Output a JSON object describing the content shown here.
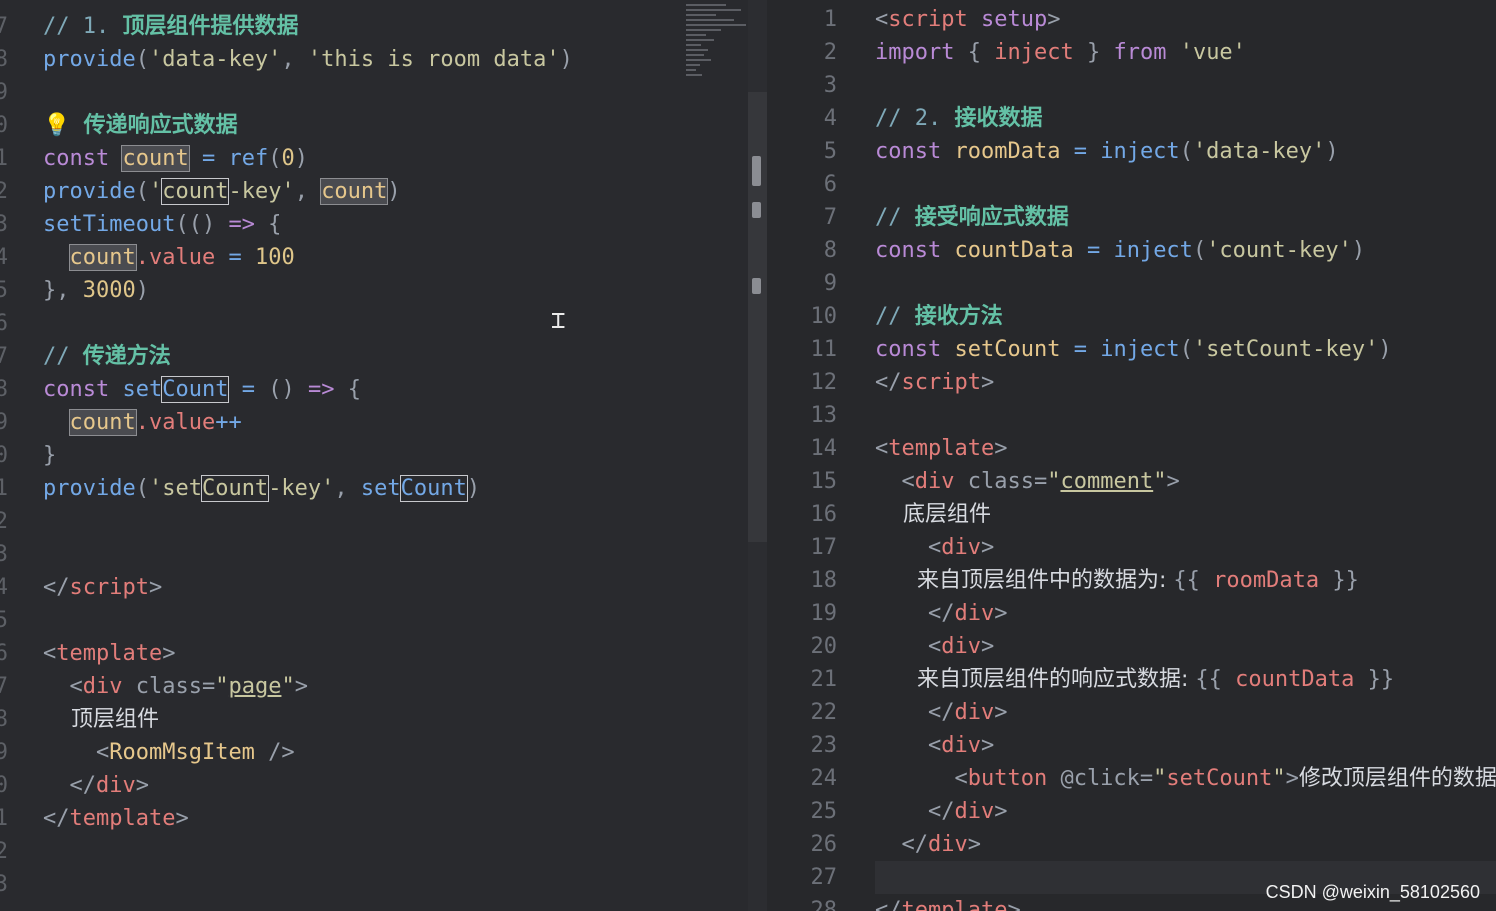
{
  "left": {
    "lines": [
      {
        "no": "7",
        "parts": [
          {
            "c": "cm",
            "t": "// 1. "
          },
          {
            "c": "cmb",
            "t": "顶层组件提供数据"
          }
        ]
      },
      {
        "no": "8",
        "parts": [
          {
            "c": "fn",
            "t": "provide"
          },
          {
            "c": "pr",
            "t": "("
          },
          {
            "c": "str",
            "t": "'data-key'"
          },
          {
            "c": "pr",
            "t": ", "
          },
          {
            "c": "str",
            "t": "'this is room data'"
          },
          {
            "c": "pr",
            "t": ")"
          }
        ]
      },
      {
        "no": "9",
        "parts": []
      },
      {
        "no": "0",
        "parts": [
          {
            "c": "num",
            "t": "💡 "
          },
          {
            "c": "cmb",
            "t": "传递响应式数据"
          }
        ]
      },
      {
        "no": "1",
        "parts": [
          {
            "c": "kw",
            "t": "const "
          },
          {
            "c": "var hl",
            "t": "count"
          },
          {
            "c": "op",
            "t": " = "
          },
          {
            "c": "fn",
            "t": "ref"
          },
          {
            "c": "pr",
            "t": "("
          },
          {
            "c": "num",
            "t": "0"
          },
          {
            "c": "pr",
            "t": ")"
          }
        ]
      },
      {
        "no": "2",
        "parts": [
          {
            "c": "fn",
            "t": "provide"
          },
          {
            "c": "pr",
            "t": "("
          },
          {
            "c": "str",
            "t": "'"
          },
          {
            "c": "str box",
            "t": "count"
          },
          {
            "c": "str",
            "t": "-key'"
          },
          {
            "c": "pr",
            "t": ", "
          },
          {
            "c": "var hl",
            "t": "count"
          },
          {
            "c": "pr",
            "t": ")"
          }
        ]
      },
      {
        "no": "3",
        "parts": [
          {
            "c": "fn",
            "t": "setTimeout"
          },
          {
            "c": "pr",
            "t": "(() "
          },
          {
            "c": "kw",
            "t": "=>"
          },
          {
            "c": "pr",
            "t": " {"
          }
        ]
      },
      {
        "no": "4",
        "parts": [
          {
            "c": "pr",
            "t": "  "
          },
          {
            "c": "var hl",
            "t": "count"
          },
          {
            "c": "tag",
            "t": ".value"
          },
          {
            "c": "op",
            "t": " = "
          },
          {
            "c": "num",
            "t": "100"
          }
        ]
      },
      {
        "no": "5",
        "parts": [
          {
            "c": "pr",
            "t": "}, "
          },
          {
            "c": "num",
            "t": "3000"
          },
          {
            "c": "pr",
            "t": ")"
          }
        ]
      },
      {
        "no": "6",
        "parts": []
      },
      {
        "no": "7",
        "parts": [
          {
            "c": "cm",
            "t": "// "
          },
          {
            "c": "cmb",
            "t": "传递方法"
          }
        ]
      },
      {
        "no": "8",
        "parts": [
          {
            "c": "kw",
            "t": "const "
          },
          {
            "c": "fn",
            "t": "set"
          },
          {
            "c": "fn box",
            "t": "Count"
          },
          {
            "c": "op",
            "t": " = "
          },
          {
            "c": "pr",
            "t": "() "
          },
          {
            "c": "kw",
            "t": "=>"
          },
          {
            "c": "pr",
            "t": " {"
          }
        ]
      },
      {
        "no": "9",
        "parts": [
          {
            "c": "pr",
            "t": "  "
          },
          {
            "c": "var hl",
            "t": "count"
          },
          {
            "c": "tag",
            "t": ".value"
          },
          {
            "c": "op",
            "t": "++"
          }
        ]
      },
      {
        "no": "0",
        "parts": [
          {
            "c": "pr",
            "t": "}"
          }
        ]
      },
      {
        "no": "1",
        "parts": [
          {
            "c": "fn",
            "t": "provide"
          },
          {
            "c": "pr",
            "t": "("
          },
          {
            "c": "str",
            "t": "'set"
          },
          {
            "c": "str box",
            "t": "Count"
          },
          {
            "c": "str",
            "t": "-key'"
          },
          {
            "c": "pr",
            "t": ", "
          },
          {
            "c": "fn",
            "t": "set"
          },
          {
            "c": "fn box",
            "t": "Count"
          },
          {
            "c": "pr",
            "t": ")"
          }
        ]
      },
      {
        "no": "2",
        "parts": []
      },
      {
        "no": "3",
        "parts": []
      },
      {
        "no": "4",
        "parts": [
          {
            "c": "pr",
            "t": "</"
          },
          {
            "c": "tag",
            "t": "script"
          },
          {
            "c": "pr",
            "t": ">"
          }
        ]
      },
      {
        "no": "5",
        "parts": []
      },
      {
        "no": "6",
        "parts": [
          {
            "c": "pr",
            "t": "<"
          },
          {
            "c": "tag",
            "t": "template"
          },
          {
            "c": "pr",
            "t": ">"
          }
        ]
      },
      {
        "no": "7",
        "parts": [
          {
            "c": "pr",
            "t": "  <"
          },
          {
            "c": "tag",
            "t": "div"
          },
          {
            "c": "pr",
            "t": " class="
          },
          {
            "c": "str",
            "t": "\""
          },
          {
            "c": "str u",
            "t": "page"
          },
          {
            "c": "str",
            "t": "\""
          },
          {
            "c": "pr",
            "t": ">"
          }
        ]
      },
      {
        "no": "8",
        "parts": [
          {
            "c": "txt",
            "t": "    顶层组件"
          }
        ]
      },
      {
        "no": "9",
        "parts": [
          {
            "c": "pr",
            "t": "    <"
          },
          {
            "c": "var",
            "t": "RoomMsgItem"
          },
          {
            "c": "pr",
            "t": " />"
          }
        ]
      },
      {
        "no": "0",
        "parts": [
          {
            "c": "pr",
            "t": "  </"
          },
          {
            "c": "tag",
            "t": "div"
          },
          {
            "c": "pr",
            "t": ">"
          }
        ]
      },
      {
        "no": "1",
        "parts": [
          {
            "c": "pr",
            "t": "</"
          },
          {
            "c": "tag",
            "t": "template"
          },
          {
            "c": "pr",
            "t": ">"
          }
        ]
      },
      {
        "no": "2",
        "parts": []
      },
      {
        "no": "3",
        "parts": []
      }
    ]
  },
  "right": {
    "lines": [
      {
        "no": "1",
        "parts": [
          {
            "c": "pr",
            "t": "<"
          },
          {
            "c": "tag",
            "t": "script"
          },
          {
            "c": "kw",
            "t": " setup"
          },
          {
            "c": "pr",
            "t": ">"
          }
        ]
      },
      {
        "no": "2",
        "parts": [
          {
            "c": "kw",
            "t": "import"
          },
          {
            "c": "pr",
            "t": " { "
          },
          {
            "c": "tag",
            "t": "inject"
          },
          {
            "c": "pr",
            "t": " } "
          },
          {
            "c": "kw",
            "t": "from"
          },
          {
            "c": "str",
            "t": " 'vue'"
          }
        ]
      },
      {
        "no": "3",
        "parts": []
      },
      {
        "no": "4",
        "parts": [
          {
            "c": "cm",
            "t": "// 2. "
          },
          {
            "c": "cmb",
            "t": "接收数据"
          }
        ]
      },
      {
        "no": "5",
        "parts": [
          {
            "c": "kw",
            "t": "const "
          },
          {
            "c": "var",
            "t": "roomData"
          },
          {
            "c": "op",
            "t": " = "
          },
          {
            "c": "fn",
            "t": "inject"
          },
          {
            "c": "pr",
            "t": "("
          },
          {
            "c": "str",
            "t": "'data-key'"
          },
          {
            "c": "pr",
            "t": ")"
          }
        ]
      },
      {
        "no": "6",
        "parts": []
      },
      {
        "no": "7",
        "parts": [
          {
            "c": "cm",
            "t": "// "
          },
          {
            "c": "cmb",
            "t": "接受响应式数据"
          }
        ]
      },
      {
        "no": "8",
        "parts": [
          {
            "c": "kw",
            "t": "const "
          },
          {
            "c": "var",
            "t": "countData"
          },
          {
            "c": "op",
            "t": " = "
          },
          {
            "c": "fn",
            "t": "inject"
          },
          {
            "c": "pr",
            "t": "("
          },
          {
            "c": "str",
            "t": "'count-key'"
          },
          {
            "c": "pr",
            "t": ")"
          }
        ]
      },
      {
        "no": "9",
        "parts": []
      },
      {
        "no": "10",
        "parts": [
          {
            "c": "cm",
            "t": "// "
          },
          {
            "c": "cmb",
            "t": "接收方法"
          }
        ]
      },
      {
        "no": "11",
        "parts": [
          {
            "c": "kw",
            "t": "const "
          },
          {
            "c": "var",
            "t": "setCount"
          },
          {
            "c": "op",
            "t": " = "
          },
          {
            "c": "fn",
            "t": "inject"
          },
          {
            "c": "pr",
            "t": "("
          },
          {
            "c": "str",
            "t": "'setCount-key'"
          },
          {
            "c": "pr",
            "t": ")"
          }
        ]
      },
      {
        "no": "12",
        "parts": [
          {
            "c": "pr",
            "t": "</"
          },
          {
            "c": "tag",
            "t": "script"
          },
          {
            "c": "pr",
            "t": ">"
          }
        ]
      },
      {
        "no": "13",
        "parts": []
      },
      {
        "no": "14",
        "parts": [
          {
            "c": "pr",
            "t": "<"
          },
          {
            "c": "tag",
            "t": "template"
          },
          {
            "c": "pr",
            "t": ">"
          }
        ]
      },
      {
        "no": "15",
        "parts": [
          {
            "c": "pr",
            "t": "  <"
          },
          {
            "c": "tag",
            "t": "div"
          },
          {
            "c": "pr",
            "t": " class="
          },
          {
            "c": "str",
            "t": "\""
          },
          {
            "c": "str u",
            "t": "comment"
          },
          {
            "c": "str",
            "t": "\""
          },
          {
            "c": "pr",
            "t": ">"
          }
        ]
      },
      {
        "no": "16",
        "parts": [
          {
            "c": "txt",
            "t": "    底层组件"
          }
        ]
      },
      {
        "no": "17",
        "parts": [
          {
            "c": "pr",
            "t": "    <"
          },
          {
            "c": "tag",
            "t": "div"
          },
          {
            "c": "pr",
            "t": ">"
          }
        ]
      },
      {
        "no": "18",
        "parts": [
          {
            "c": "txt",
            "t": "      来自顶层组件中的数据为: "
          },
          {
            "c": "pr",
            "t": "{{ "
          },
          {
            "c": "tag",
            "t": "roomData"
          },
          {
            "c": "pr",
            "t": " }}"
          }
        ]
      },
      {
        "no": "19",
        "parts": [
          {
            "c": "pr",
            "t": "    </"
          },
          {
            "c": "tag",
            "t": "div"
          },
          {
            "c": "pr",
            "t": ">"
          }
        ]
      },
      {
        "no": "20",
        "parts": [
          {
            "c": "pr",
            "t": "    <"
          },
          {
            "c": "tag",
            "t": "div"
          },
          {
            "c": "pr",
            "t": ">"
          }
        ]
      },
      {
        "no": "21",
        "parts": [
          {
            "c": "txt",
            "t": "      来自顶层组件的响应式数据: "
          },
          {
            "c": "pr",
            "t": "{{ "
          },
          {
            "c": "tag",
            "t": "countData"
          },
          {
            "c": "pr",
            "t": " }}"
          }
        ]
      },
      {
        "no": "22",
        "parts": [
          {
            "c": "pr",
            "t": "    </"
          },
          {
            "c": "tag",
            "t": "div"
          },
          {
            "c": "pr",
            "t": ">"
          }
        ]
      },
      {
        "no": "23",
        "parts": [
          {
            "c": "pr",
            "t": "    <"
          },
          {
            "c": "tag",
            "t": "div"
          },
          {
            "c": "pr",
            "t": ">"
          }
        ]
      },
      {
        "no": "24",
        "parts": [
          {
            "c": "pr",
            "t": "      <"
          },
          {
            "c": "tag",
            "t": "button"
          },
          {
            "c": "pr",
            "t": " @click="
          },
          {
            "c": "str",
            "t": "\""
          },
          {
            "c": "tag",
            "t": "setCount"
          },
          {
            "c": "str",
            "t": "\""
          },
          {
            "c": "pr",
            "t": ">"
          },
          {
            "c": "txt",
            "t": "修改顶层组件的数据"
          }
        ]
      },
      {
        "no": "25",
        "parts": [
          {
            "c": "pr",
            "t": "    </"
          },
          {
            "c": "tag",
            "t": "div"
          },
          {
            "c": "pr",
            "t": ">"
          }
        ]
      },
      {
        "no": "26",
        "parts": [
          {
            "c": "pr",
            "t": "  </"
          },
          {
            "c": "tag",
            "t": "div"
          },
          {
            "c": "pr",
            "t": ">"
          }
        ]
      },
      {
        "no": "27",
        "parts": []
      },
      {
        "no": "28",
        "parts": [
          {
            "c": "pr",
            "t": "</"
          },
          {
            "c": "tag",
            "t": "template"
          },
          {
            "c": "pr",
            "t": ">"
          }
        ]
      }
    ]
  },
  "watermark": "CSDN @weixin_58102560"
}
